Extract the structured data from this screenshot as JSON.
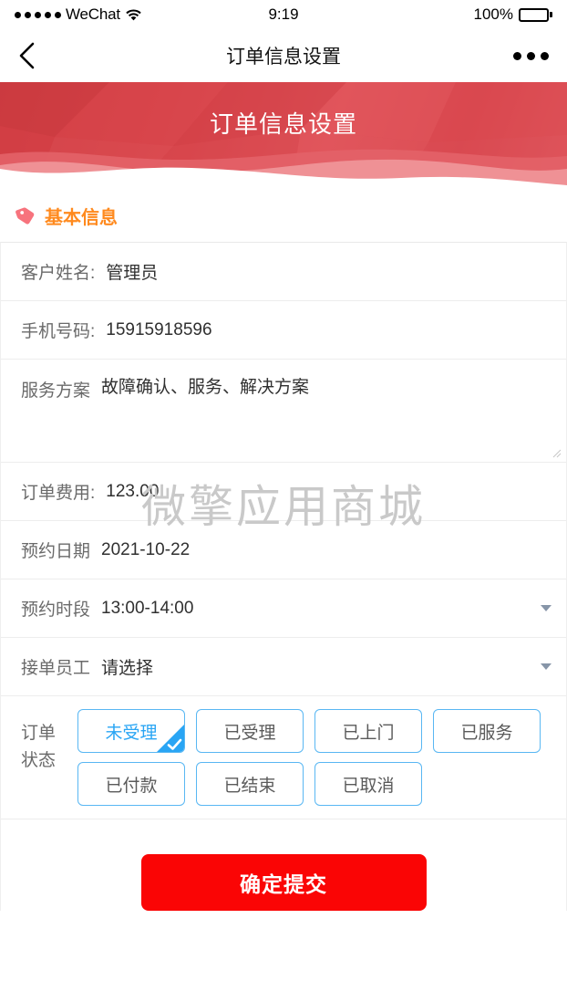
{
  "status_bar": {
    "carrier": "WeChat",
    "signal_dots": 5,
    "wifi_icon": "wifi-icon",
    "time": "9:19",
    "battery_percent": "100%",
    "battery_icon": "battery-full-icon"
  },
  "nav": {
    "back_icon": "chevron-left-icon",
    "title": "订单信息设置",
    "more_icon": "more-horizontal-icon"
  },
  "banner": {
    "title": "订单信息设置",
    "color_top": "#cf3b40",
    "color_bottom": "#e15a60",
    "wave_dark": "#dd4a50",
    "wave_light": "#eb8d90"
  },
  "section": {
    "icon": "tag-icon",
    "icon_color": "#f7737d",
    "title": "基本信息",
    "title_color": "#ff8a1e"
  },
  "fields": [
    {
      "name": "customer-name",
      "label": "客户姓名:",
      "value": "管理员",
      "type": "text"
    },
    {
      "name": "phone-number",
      "label": "手机号码:",
      "value": "15915918596",
      "type": "text"
    },
    {
      "name": "service-plan",
      "label": "服务方案",
      "value": "故障确认、服务、解决方案",
      "type": "textarea"
    },
    {
      "name": "order-fee",
      "label": "订单费用:",
      "value": "123.00",
      "type": "text"
    },
    {
      "name": "appointment-date",
      "label": "预约日期",
      "value": "2021-10-22",
      "type": "date"
    },
    {
      "name": "appointment-time",
      "label": "预约时段",
      "value": "13:00-14:00",
      "type": "select"
    },
    {
      "name": "assigned-staff",
      "label": "接单员工",
      "value": "请选择",
      "type": "select"
    }
  ],
  "order_status": {
    "label_line1": "订单",
    "label_line2": "状态",
    "selected": "未受理",
    "accent_color": "#29a5f4",
    "border_color": "#59b7f3",
    "options": [
      {
        "label": "未受理",
        "selected": true
      },
      {
        "label": "已受理",
        "selected": false
      },
      {
        "label": "已上门",
        "selected": false
      },
      {
        "label": "已服务",
        "selected": false
      },
      {
        "label": "已付款",
        "selected": false
      },
      {
        "label": "已结束",
        "selected": false
      },
      {
        "label": "已取消",
        "selected": false
      }
    ]
  },
  "submit": {
    "label": "确定提交",
    "color": "#fa0505"
  },
  "watermark": {
    "text": "微擎应用商城",
    "color": "#c9c9c9"
  }
}
